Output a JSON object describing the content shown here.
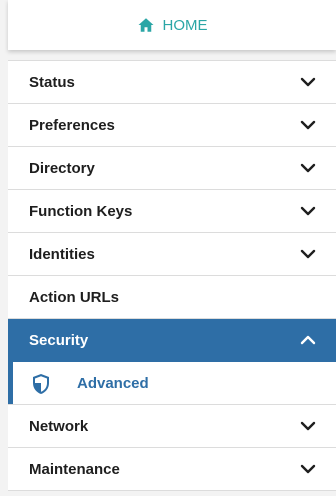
{
  "home": {
    "label": "HOME",
    "icon": "home-icon"
  },
  "menu": {
    "items": [
      {
        "label": "Status",
        "icon": "chevron-down-icon"
      },
      {
        "label": "Preferences",
        "icon": "chevron-down-icon"
      },
      {
        "label": "Directory",
        "icon": "chevron-down-icon"
      },
      {
        "label": "Function Keys",
        "icon": "chevron-down-icon"
      },
      {
        "label": "Identities",
        "icon": "chevron-down-icon"
      },
      {
        "label": "Action URLs"
      },
      {
        "label": "Security",
        "icon": "chevron-up-icon",
        "active": true
      },
      {
        "label": "Network",
        "icon": "chevron-down-icon"
      },
      {
        "label": "Maintenance",
        "icon": "chevron-down-icon"
      }
    ],
    "submenu": {
      "label": "Advanced",
      "icon": "shield-icon"
    }
  },
  "colors": {
    "accent": "#2e6ea6",
    "home": "#2ba6a6",
    "text": "#1e1e1e",
    "divider": "#dcdcdc"
  }
}
